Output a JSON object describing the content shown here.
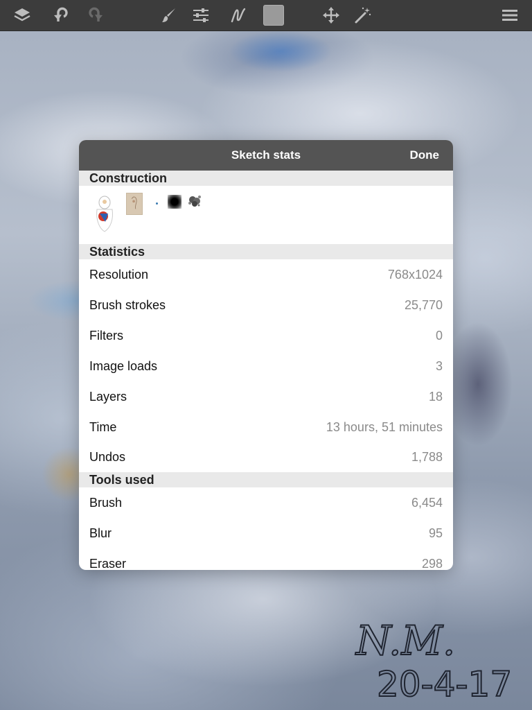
{
  "toolbar": {
    "items": [
      {
        "name": "layers-icon"
      },
      {
        "name": "undo-icon"
      },
      {
        "name": "redo-icon"
      },
      {
        "name": "brush-icon"
      },
      {
        "name": "adjustments-icon"
      },
      {
        "name": "brush-properties-icon"
      },
      {
        "name": "color-swatch",
        "color": "#9a9a9a"
      },
      {
        "name": "transform-icon"
      },
      {
        "name": "magic-wand-icon"
      },
      {
        "name": "menu-icon"
      }
    ]
  },
  "dialog": {
    "title": "Sketch stats",
    "done_label": "Done",
    "sections": {
      "construction": "Construction",
      "statistics": "Statistics",
      "tools_used": "Tools used"
    },
    "statistics": [
      {
        "label": "Resolution",
        "value": "768x1024"
      },
      {
        "label": "Brush strokes",
        "value": "25,770"
      },
      {
        "label": "Filters",
        "value": "0"
      },
      {
        "label": "Image loads",
        "value": "3"
      },
      {
        "label": "Layers",
        "value": "18"
      },
      {
        "label": "Time",
        "value": "13 hours, 51 minutes"
      },
      {
        "label": "Undos",
        "value": "1,788"
      }
    ],
    "tools": [
      {
        "label": "Brush",
        "value": "6,454"
      },
      {
        "label": "Blur",
        "value": "95"
      },
      {
        "label": "Eraser",
        "value": "298"
      }
    ]
  },
  "canvas": {
    "signature_initials": "N.M.",
    "signature_date": "20-4-17"
  },
  "colors": {
    "toolbar_bg": "#3c3c3c",
    "dialog_header_bg": "#545454",
    "section_header_bg": "#e9e9e9",
    "value_text": "#8a8a8a"
  }
}
